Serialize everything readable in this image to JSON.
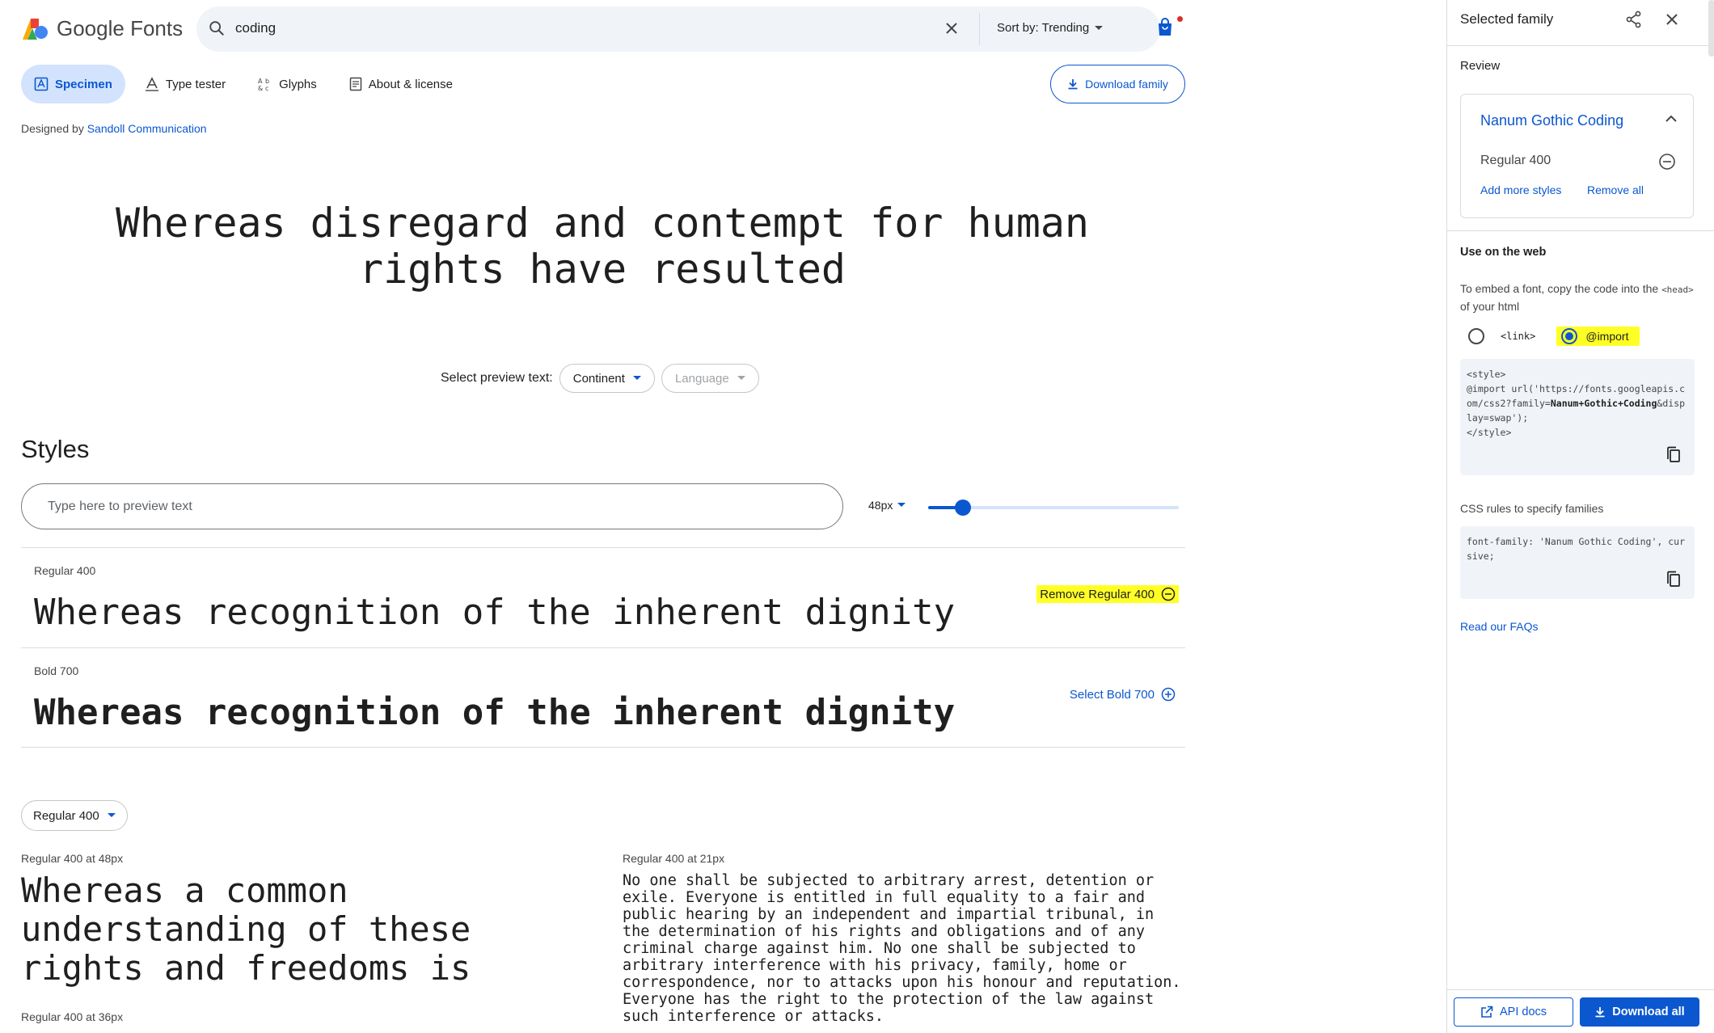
{
  "header": {
    "logo_text": "Google Fonts",
    "search_value": "coding",
    "sort_label": "Sort by: Trending"
  },
  "tabs": [
    {
      "label": "Specimen",
      "active": true
    },
    {
      "label": "Type tester"
    },
    {
      "label": "Glyphs"
    },
    {
      "label": "About & license"
    }
  ],
  "download_family": "Download family",
  "designer": {
    "prefix": "Designed by",
    "name": "Sandoll Communication"
  },
  "hero_text": "Whereas disregard and contempt for human rights have resulted",
  "preview_selector": {
    "label": "Select preview text:",
    "continent": "Continent",
    "language": "Language"
  },
  "styles": {
    "heading": "Styles",
    "placeholder": "Type here to preview text",
    "size": "48px",
    "slider_fraction": 0.14,
    "rows": [
      {
        "label": "Regular 400",
        "sample": "Whereas recognition of the inherent dignity",
        "action": "Remove Regular 400",
        "selected": true
      },
      {
        "label": "Bold 700",
        "sample": "Whereas recognition of the inherent dignity",
        "action": "Select Bold 700",
        "selected": false
      }
    ]
  },
  "style_dropdown": "Regular 400",
  "samples": {
    "big_label": "Regular 400 at 48px",
    "big_text": "Whereas a common understanding of these rights and freedoms is",
    "small_label": "Regular 400 at 21px",
    "small_text": "No one shall be subjected to arbitrary arrest, detention or exile. Everyone is entitled in full equality to a fair and public hearing by an independent and impartial tribunal, in the determination of his rights and obligations and of any criminal charge against him. No one shall be subjected to arbitrary interference with his privacy, family, home or correspondence, nor to attacks upon his honour and reputation. Everyone has the right to the protection of the law against such interference or attacks.",
    "next_label": "Regular 400 at 36px"
  },
  "panel": {
    "title": "Selected family",
    "review": "Review",
    "family_name": "Nanum Gothic Coding",
    "style": "Regular 400",
    "add_more": "Add more styles",
    "remove_all": "Remove all",
    "use_on_web": "Use on the web",
    "embed_pre": "To embed a font, copy the code into the",
    "embed_code": "<head>",
    "embed_post": "of your html",
    "radio_link": "<link>",
    "radio_import": "@import",
    "code_line1": "<style>",
    "code_line2a": "@import url('https://fonts.googleapis.com/css2?family=",
    "code_line2b": "Nanum+Gothic+Coding",
    "code_line2c": "&display=swap');",
    "code_line3": "</style>",
    "css_rules_label": "CSS rules to specify families",
    "css_rule": "font-family: 'Nanum Gothic Coding', cursive;",
    "faq": "Read our FAQs",
    "api_docs": "API docs",
    "download_all": "Download all"
  },
  "colors": {
    "accent": "#0b57d0",
    "highlight": "#ffff26"
  }
}
